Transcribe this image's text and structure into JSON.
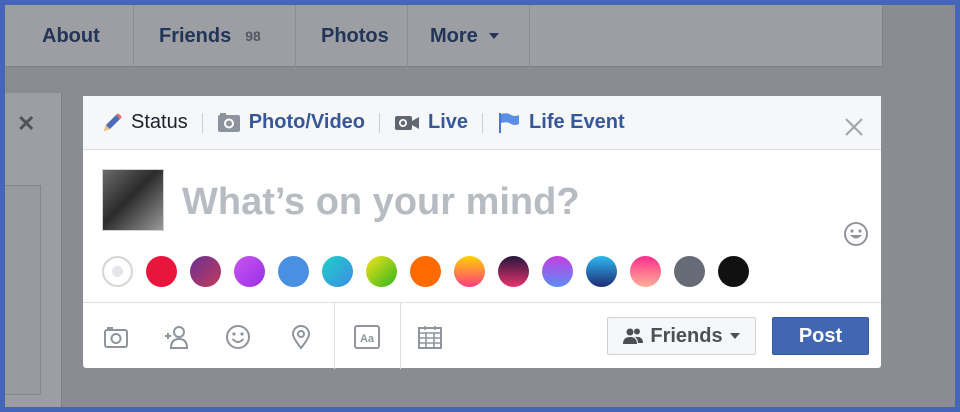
{
  "profile_nav": {
    "about": "About",
    "friends": "Friends",
    "friends_count": "98",
    "photos": "Photos",
    "more": "More"
  },
  "composer": {
    "tabs": [
      {
        "label": "Status",
        "icon": "pencil-icon",
        "active": true
      },
      {
        "label": "Photo/Video",
        "icon": "camera-icon"
      },
      {
        "label": "Live",
        "icon": "video-camera-icon"
      },
      {
        "label": "Life Event",
        "icon": "flag-icon"
      }
    ],
    "placeholder": "What’s on your mind?",
    "background_colors": [
      "#ffffff",
      "#e9153c",
      "#6a3093 → #b23a48",
      "#b845f0",
      "#4a90e2",
      "#1fd0c6 → #3c8ce7",
      "#78c814 → #f7e51a",
      "#ff6a00",
      "#ff3d7f → #ffd200",
      "#24173c → #e8336d",
      "#c33ee0 → #5d8ef7",
      "#1e3c72 → #2fb8f2",
      "#ff2d8a → #ffb199",
      "#666b76",
      "#111111"
    ],
    "audience": "Friends",
    "post_label": "Post"
  },
  "colors": {
    "link_blue": "#365899",
    "post_button": "#4267b2",
    "overlay": "#8a8c91",
    "frame_border": "#4566b8"
  }
}
